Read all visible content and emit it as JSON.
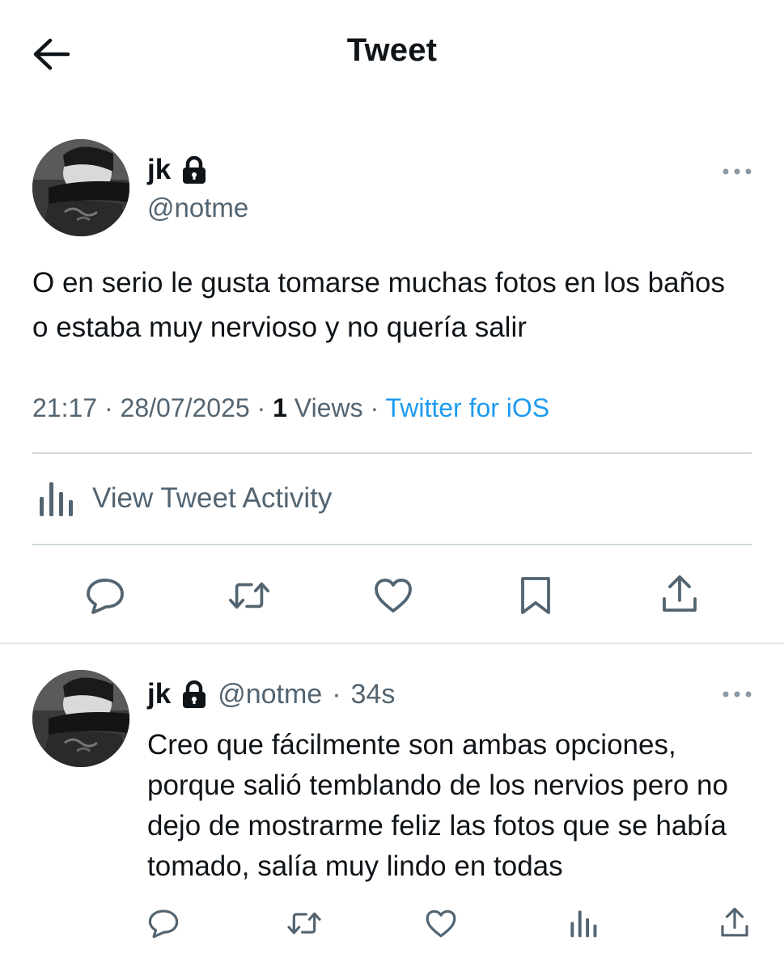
{
  "header": {
    "title": "Tweet"
  },
  "tweet": {
    "author_name": "jk",
    "author_handle": "@notme",
    "text": "O en serio le gusta tomarse muchas fotos en los baños o estaba muy nervioso y no quería salir",
    "time": "21:17",
    "date": "28/07/2025",
    "views_count": "1",
    "views_label": "Views",
    "source": "Twitter for iOS",
    "activity_label": "View Tweet Activity"
  },
  "reply": {
    "author_name": "jk",
    "author_handle": "@notme",
    "age": "34s",
    "text": "Creo que fácilmente son ambas opciones, porque salió temblando de los nervios pero no dejo de mostrarme feliz las fotos que se había tomado, salía muy lindo en todas"
  },
  "icons": [
    "back-arrow-icon",
    "lock-icon",
    "more-icon",
    "analytics-icon",
    "reply-icon",
    "retweet-icon",
    "like-icon",
    "bookmark-icon",
    "share-icon"
  ],
  "colors": {
    "text": "#0f1419",
    "secondary": "#536471",
    "link": "#1d9bf0",
    "divider": "#cfd9de"
  }
}
